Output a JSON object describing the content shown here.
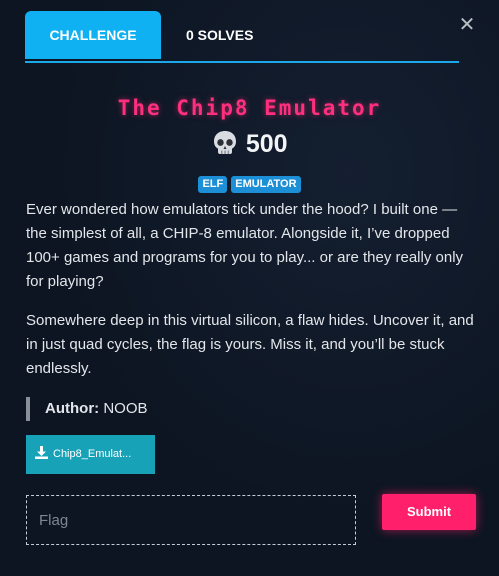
{
  "tabs": {
    "challenge_label": "CHALLENGE",
    "solves_label": "0 SOLVES"
  },
  "close_icon": "close-icon",
  "challenge": {
    "title": "The Chip8 Emulator",
    "value": "500",
    "value_icon": "skull-icon",
    "tags": [
      "ELF",
      "EMULATOR"
    ],
    "description": [
      "Ever wondered how emulators tick under the hood? I built one — the simplest of all, a CHIP-8 emulator. Alongside it, I’ve dropped 100+ games and programs for you to play... or are they really only for playing?",
      "Somewhere deep in this virtual silicon, a flaw hides. Uncover it, and in just quad cycles, the flag is yours. Miss it, and you’ll be stuck endlessly."
    ],
    "author_label": "Author:",
    "author_name": "NOOB",
    "file_name": "Chip8_Emulat...",
    "file_icon": "download-icon"
  },
  "flag_form": {
    "placeholder": "Flag",
    "value": "",
    "submit_label": "Submit"
  },
  "colors": {
    "background": "#0d1522",
    "accent": "#10b1f2",
    "title": "#ff2f7e",
    "submit": "#ff1f6b",
    "tag": "#1c8fd6",
    "download": "#17a2b8"
  }
}
